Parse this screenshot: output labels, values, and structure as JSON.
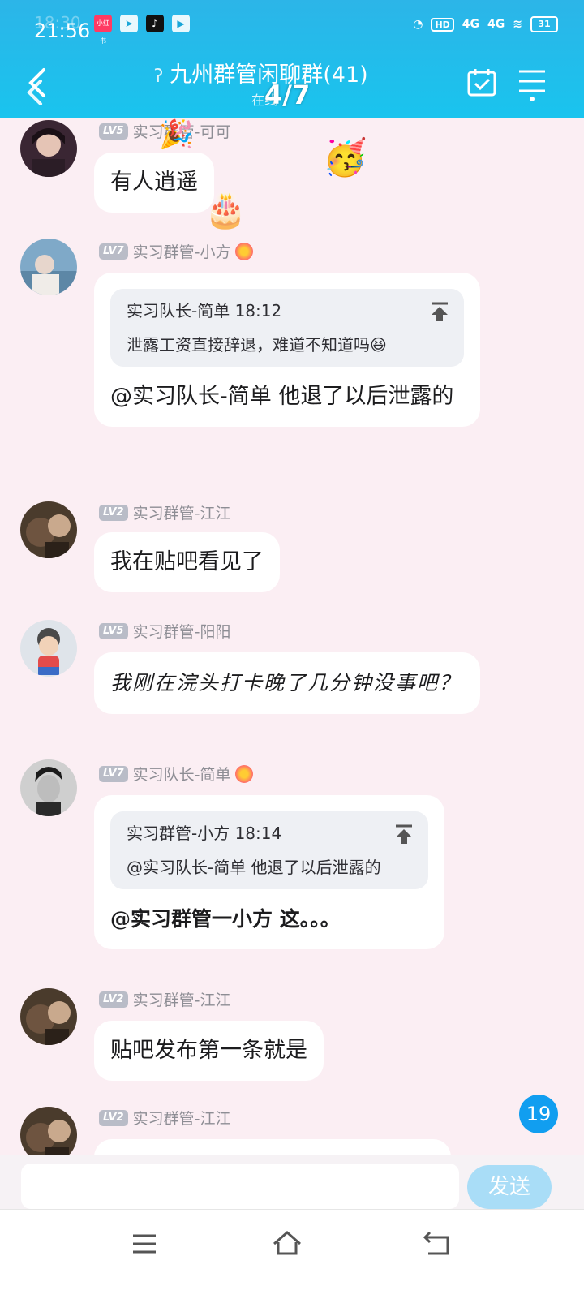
{
  "status_bar": {
    "time": "21:56",
    "ghost_time": "18:30",
    "network_1": "4G",
    "network_2": "4G",
    "hd_label": "HD",
    "battery": "31",
    "app_icons": [
      "xiaohongshu-icon",
      "telegram-icon",
      "tiktok-icon",
      "video-icon"
    ]
  },
  "header": {
    "title": "九州群管闲聊群(41)",
    "subtitle": "在线",
    "page_counter": "4/7"
  },
  "messages": [
    {
      "level": "LV5",
      "sender": "实习群管-可可",
      "text": "有人逍遥"
    },
    {
      "level": "LV7",
      "sender": "实习群管-小方",
      "quote_author_time": "实习队长-简单 18:12",
      "quote_text": "泄露工资直接辞退，难道不知道吗😆",
      "text": "@实习队长-简单 他退了以后泄露的"
    },
    {
      "level": "LV2",
      "sender": "实习群管-江江",
      "text": "我在贴吧看见了"
    },
    {
      "level": "LV5",
      "sender": "实习群管-阳阳",
      "text": "我刚在浣头打卡晚了几分钟没事吧？"
    },
    {
      "level": "LV7",
      "sender": "实习队长-简单",
      "quote_author_time": "实习群管-小方 18:14",
      "quote_text": "@实习队长-简单 他退了以后泄露的",
      "text": "@实习群管一小方 这。。。"
    },
    {
      "level": "LV2",
      "sender": "实习群管-江江",
      "text": "贴吧发布第一条就是"
    },
    {
      "level": "LV2",
      "sender": "实习群管-江江",
      "text": ""
    }
  ],
  "unread_count": "19",
  "input": {
    "placeholder": "",
    "send_label": "发送"
  },
  "colors": {
    "header": "#19c4ee",
    "send": "#a9ddf7",
    "unread": "#119ef0"
  }
}
